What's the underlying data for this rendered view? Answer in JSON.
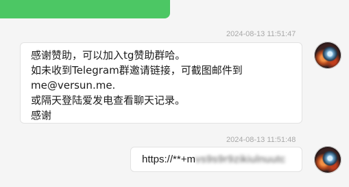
{
  "messages": [
    {
      "timestamp": "2024-08-13 11:51:47",
      "text": "感谢赞助，可以加入tg赞助群哈。\n如未收到Telegram群邀请链接，可截图邮件到me@versun.me.\n或隔天登陆爱发电查看聊天记录。\n感谢"
    },
    {
      "timestamp": "2024-08-13 11:51:48",
      "url_visible": "https://**+m",
      "url_obscured": "vs9s9r9zikiulnuutc"
    }
  ],
  "colors": {
    "accent_green": "#4cc764",
    "background": "#f5f5f5",
    "bubble": "#ffffff"
  }
}
